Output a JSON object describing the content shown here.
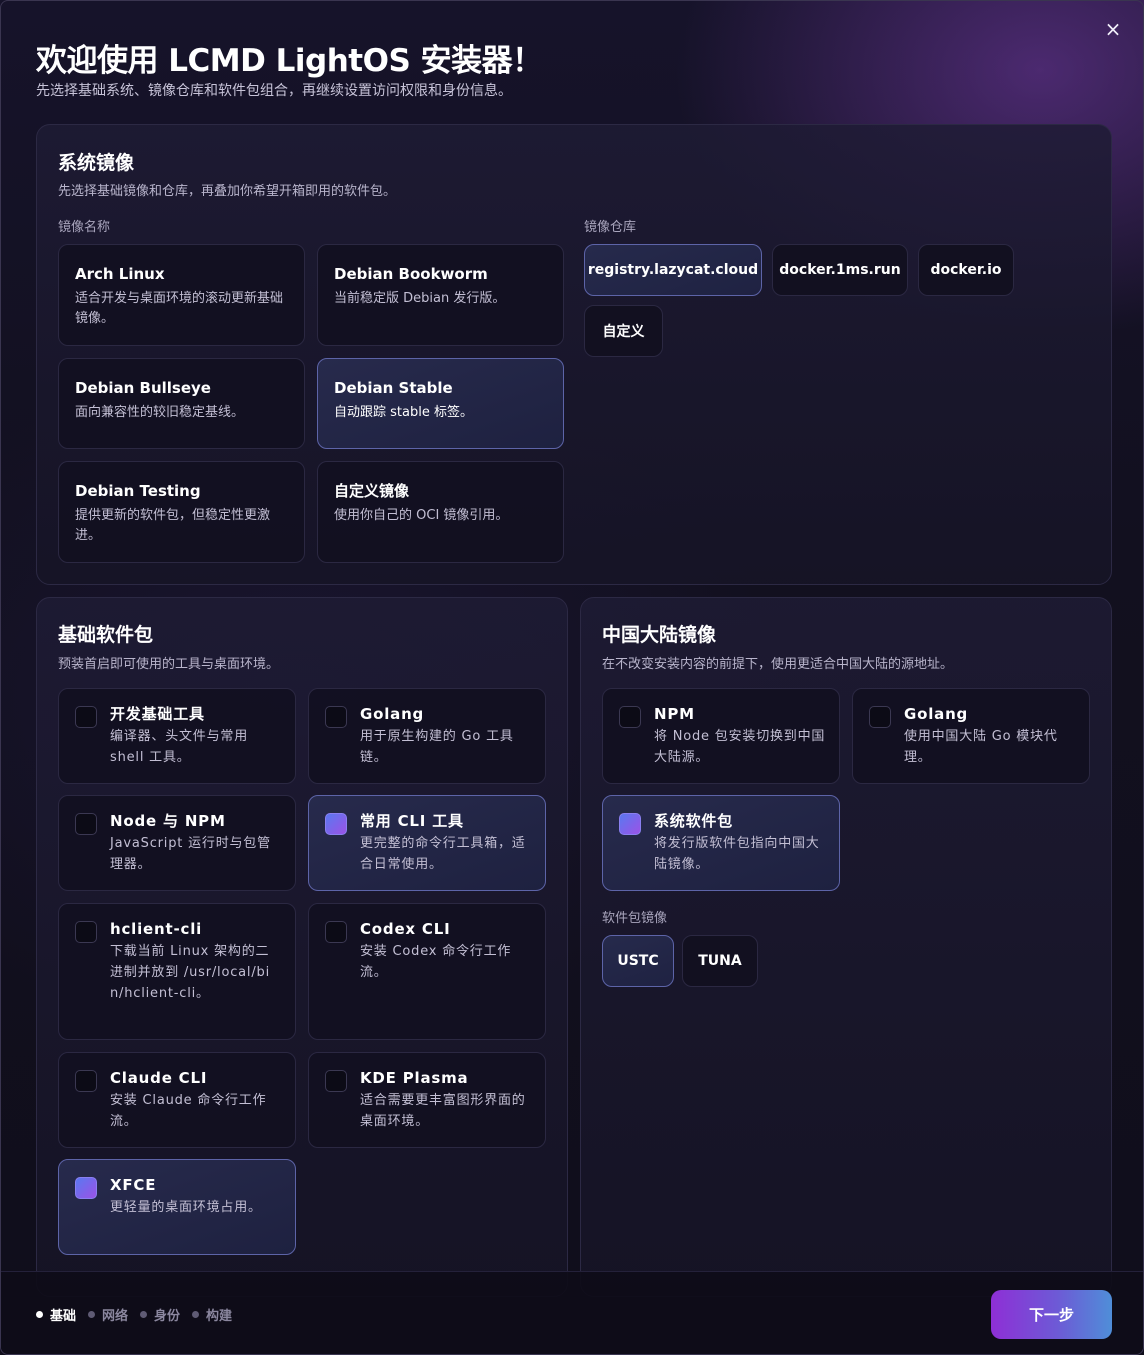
{
  "window": {
    "close_glyph": "×"
  },
  "header": {
    "title": "欢迎使用 LCMD LightOS 安装器！",
    "subtitle": "先选择基础系统、镜像仓库和软件包组合，再继续设置访问权限和身份信息。"
  },
  "system_image": {
    "title": "系统镜像",
    "desc": "先选择基础镜像和仓库，再叠加你希望开箱即用的软件包。",
    "image_label": "镜像名称",
    "registry_label": "镜像仓库",
    "images": [
      {
        "name": "Arch Linux",
        "desc": "适合开发与桌面环境的滚动更新基础镜像。",
        "selected": false
      },
      {
        "name": "Debian Bookworm",
        "desc": "当前稳定版 Debian 发行版。",
        "selected": false
      },
      {
        "name": "Debian Bullseye",
        "desc": "面向兼容性的较旧稳定基线。",
        "selected": false
      },
      {
        "name": "Debian Stable",
        "desc": "自动跟踪 stable 标签。",
        "selected": true
      },
      {
        "name": "Debian Testing",
        "desc": "提供更新的软件包，但稳定性更激进。",
        "selected": false
      },
      {
        "name": "自定义镜像",
        "desc": "使用你自己的 OCI 镜像引用。",
        "selected": false
      }
    ],
    "registries": [
      {
        "name": "registry.lazycat.cloud",
        "selected": true
      },
      {
        "name": "docker.1ms.run",
        "selected": false
      },
      {
        "name": "docker.io",
        "selected": false
      },
      {
        "name": "自定义",
        "selected": false
      }
    ]
  },
  "base_packages": {
    "title": "基础软件包",
    "desc": "预装首启即可使用的工具与桌面环境。",
    "items": [
      {
        "name": "开发基础工具",
        "desc": "编译器、头文件与常用 shell 工具。",
        "checked": false
      },
      {
        "name": "Golang",
        "desc": "用于原生构建的 Go 工具链。",
        "checked": false
      },
      {
        "name": "Node 与 NPM",
        "desc": "JavaScript 运行时与包管理器。",
        "checked": false
      },
      {
        "name": "常用 CLI 工具",
        "desc": "更完整的命令行工具箱，适合日常使用。",
        "checked": true
      },
      {
        "name": "hclient-cli",
        "desc": "下载当前 Linux 架构的二进制并放到 /usr/local/bin/hclient-cli。",
        "checked": false
      },
      {
        "name": "Codex CLI",
        "desc": "安装 Codex 命令行工作流。",
        "checked": false
      },
      {
        "name": "Claude CLI",
        "desc": "安装 Claude 命令行工作流。",
        "checked": false
      },
      {
        "name": "KDE Plasma",
        "desc": "适合需要更丰富图形界面的桌面环境。",
        "checked": false
      },
      {
        "name": "XFCE",
        "desc": "更轻量的桌面环境占用。",
        "checked": true
      }
    ]
  },
  "china_mirrors": {
    "title": "中国大陆镜像",
    "desc": "在不改变安装内容的前提下，使用更适合中国大陆的源地址。",
    "items": [
      {
        "name": "NPM",
        "desc": "将 Node 包安装切换到中国大陆源。",
        "checked": false
      },
      {
        "name": "Golang",
        "desc": "使用中国大陆 Go 模块代理。",
        "checked": false
      },
      {
        "name": "系统软件包",
        "desc": "将发行版软件包指向中国大陆镜像。",
        "checked": true
      }
    ],
    "pkg_mirror_label": "软件包镜像",
    "pkg_mirrors": [
      {
        "name": "USTC",
        "selected": true
      },
      {
        "name": "TUNA",
        "selected": false
      }
    ]
  },
  "footer": {
    "steps": [
      {
        "label": "基础",
        "active": true
      },
      {
        "label": "网络",
        "active": false
      },
      {
        "label": "身份",
        "active": false
      },
      {
        "label": "构建",
        "active": false
      }
    ],
    "next_label": "下一步"
  }
}
